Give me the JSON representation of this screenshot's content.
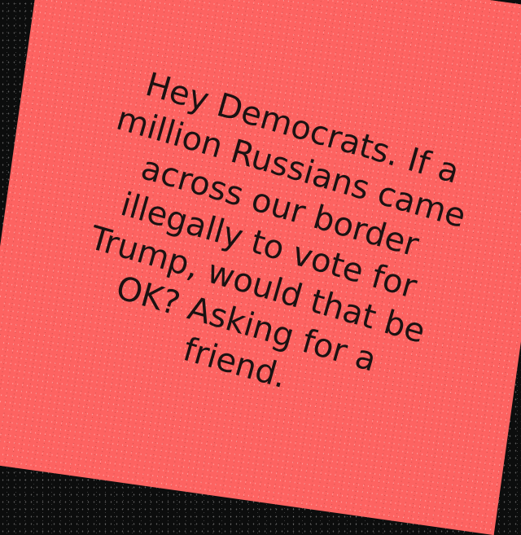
{
  "note": {
    "lines": [
      "Hey Democrats. If a",
      "million Russians came",
      "across our border",
      "illegally to vote for",
      "Trump, would that be",
      "OK? Asking for a",
      "friend."
    ],
    "background_color": "#fd6361",
    "text_color": "#1b1212"
  }
}
